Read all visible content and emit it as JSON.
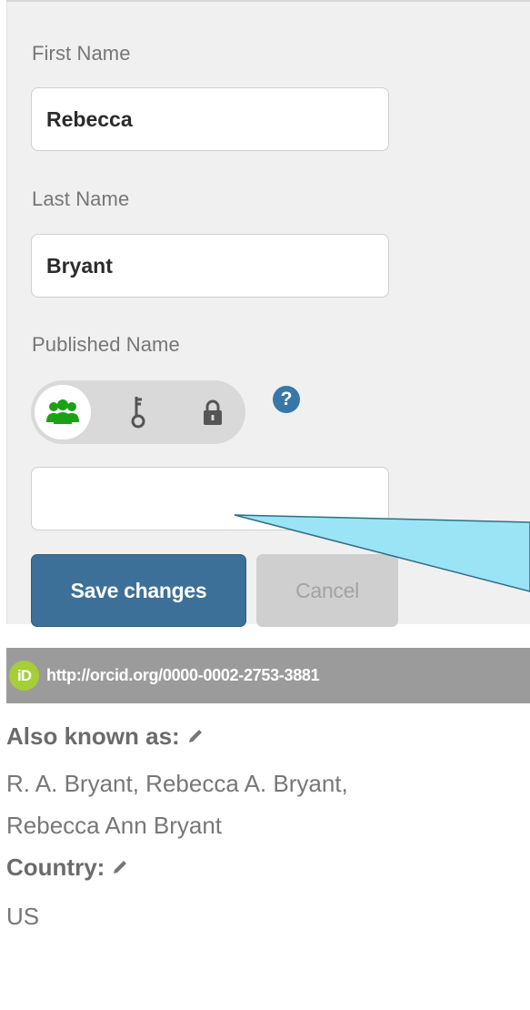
{
  "form": {
    "first_name_label": "First Name",
    "first_name_value": "Rebecca",
    "last_name_label": "Last Name",
    "last_name_value": "Bryant",
    "published_name_label": "Published Name",
    "published_name_value": "",
    "privacy_options": [
      "everyone-icon",
      "key-icon",
      "lock-icon"
    ],
    "privacy_selected": "everyone",
    "help_icon_text": "?",
    "save_label": "Save changes",
    "cancel_label": "Cancel"
  },
  "orcid": {
    "logo_text": "iD",
    "url": "http://orcid.org/0000-0002-2753-3881"
  },
  "profile": {
    "also_known_as_label": "Also known as:",
    "also_known_as_line1": "R. A. Bryant, Rebecca A. Bryant,",
    "also_known_as_line2": "Rebecca Ann Bryant",
    "country_label": "Country:",
    "country_value": "US"
  },
  "colors": {
    "primary_button": "#3d7098",
    "orcid_green": "#a6ce39",
    "privacy_green": "#1ca014",
    "callout": "#9be4f6"
  }
}
